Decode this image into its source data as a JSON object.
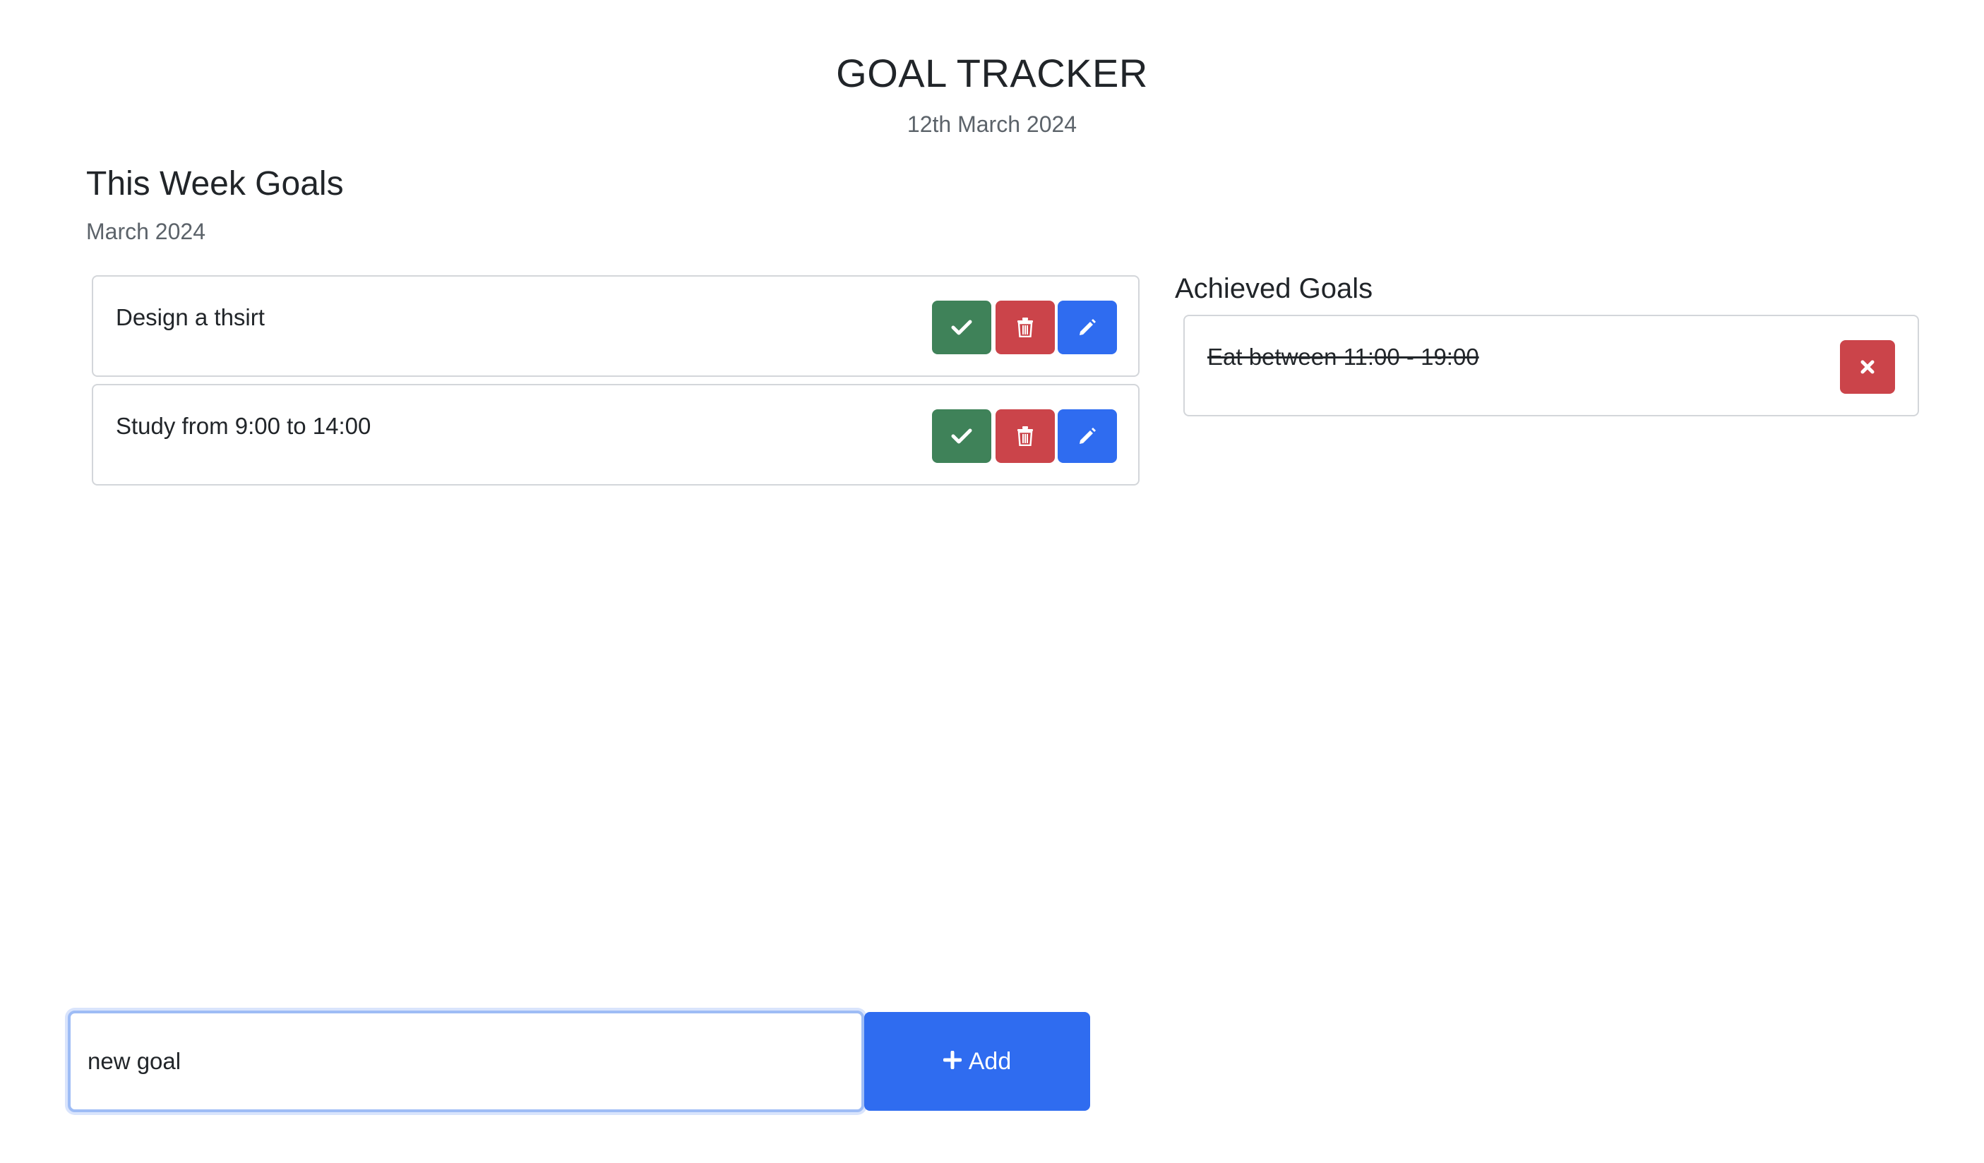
{
  "header": {
    "title": "GOAL TRACKER",
    "date": "12th March 2024"
  },
  "week": {
    "heading": "This Week Goals",
    "subheading": "March 2024",
    "goals": [
      {
        "text": "Design a thsirt"
      },
      {
        "text": "Study from 9:00 to 14:00"
      }
    ],
    "actions": {
      "complete_icon": "check-icon",
      "delete_icon": "trash-icon",
      "edit_icon": "pencil-icon"
    }
  },
  "achieved": {
    "heading": "Achieved Goals",
    "goals": [
      {
        "text": "Eat between 11:00 - 19:00"
      }
    ],
    "remove_icon": "x-icon"
  },
  "new_goal": {
    "value": "new goal",
    "add_label": "Add",
    "add_icon": "plus-icon"
  },
  "colors": {
    "complete": "#3f8259",
    "delete": "#cb444a",
    "edit": "#2f6cf0",
    "primary": "#2f6cf0"
  }
}
